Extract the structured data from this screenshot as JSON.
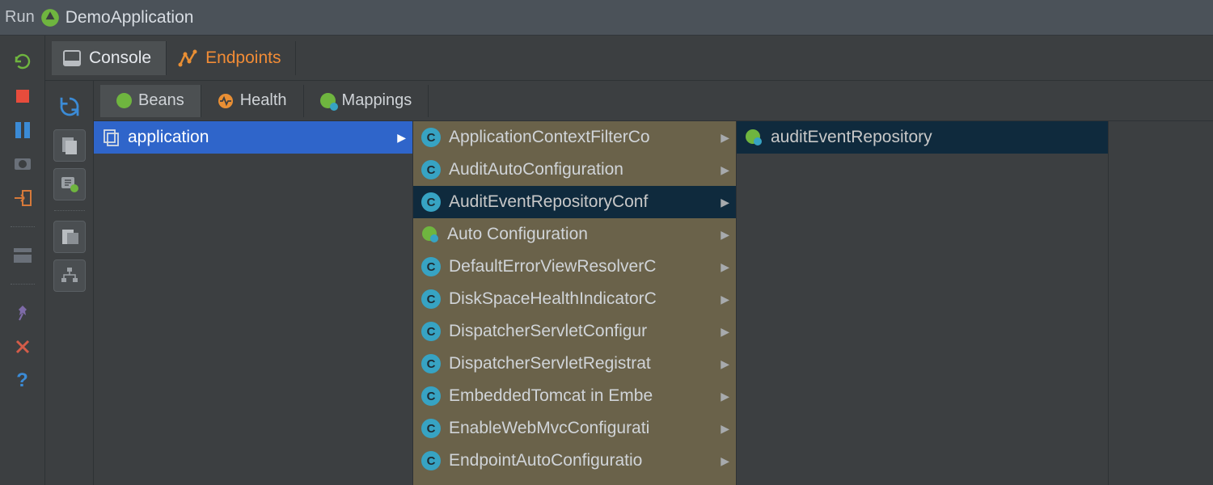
{
  "runbar": {
    "run_label": "Run",
    "app_name": "DemoApplication"
  },
  "tabs": {
    "console": "Console",
    "endpoints": "Endpoints"
  },
  "subtabs": {
    "beans": "Beans",
    "health": "Health",
    "mappings": "Mappings"
  },
  "col1": {
    "application": "application"
  },
  "col2": {
    "items": [
      {
        "label": "ApplicationContextFilterCo",
        "type": "class"
      },
      {
        "label": "AuditAutoConfiguration",
        "type": "class"
      },
      {
        "label": "AuditEventRepositoryConf",
        "type": "class"
      },
      {
        "label": "Auto Configuration",
        "type": "leaf"
      },
      {
        "label": "DefaultErrorViewResolverC",
        "type": "class"
      },
      {
        "label": "DiskSpaceHealthIndicatorC",
        "type": "class"
      },
      {
        "label": "DispatcherServletConfigur",
        "type": "class"
      },
      {
        "label": "DispatcherServletRegistrat",
        "type": "class"
      },
      {
        "label": "EmbeddedTomcat in Embe",
        "type": "class"
      },
      {
        "label": "EnableWebMvcConfigurati",
        "type": "class"
      },
      {
        "label": "EndpointAutoConfiguratio",
        "type": "class"
      }
    ],
    "selected_index": 2
  },
  "col3": {
    "item": "auditEventRepository"
  }
}
